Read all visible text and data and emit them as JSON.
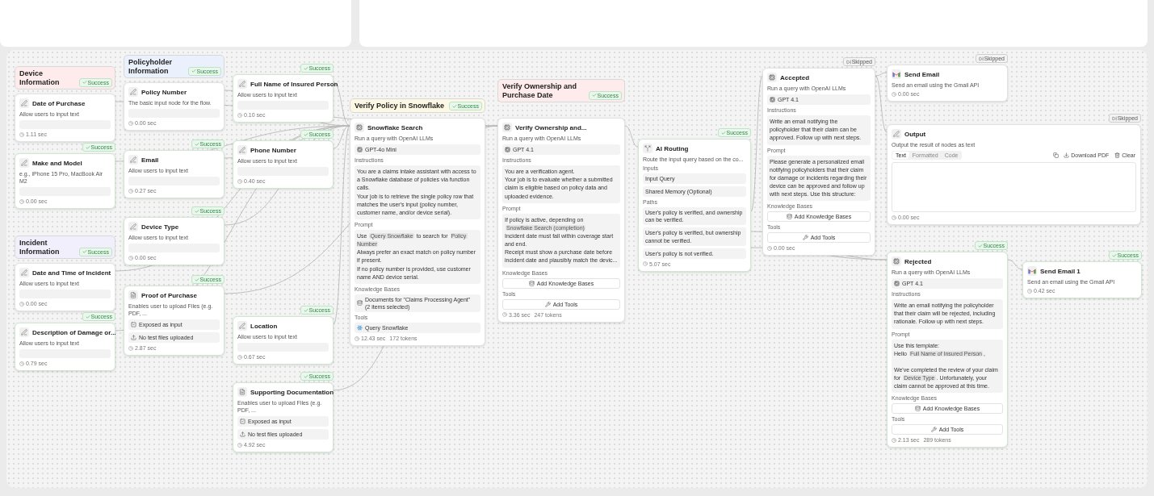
{
  "groups": [
    {
      "label": "Device Information",
      "color": "#fdeceb",
      "badge": {
        "kind": "success",
        "label": "Success"
      }
    },
    {
      "label": "Incident Information",
      "color": "#f2effc",
      "badge": {
        "kind": "success",
        "label": "Success"
      }
    },
    {
      "label": "Policyholder Information",
      "color": "#eaf1fd",
      "badge": {
        "kind": "success",
        "label": "Success"
      }
    },
    {
      "label": "Verify Policy in Snowflake",
      "color": "#fdf8e4",
      "badge": {
        "kind": "success",
        "label": "Success"
      }
    },
    {
      "label": "Verify Ownership and Purchase Date",
      "color": "#fdeceb",
      "badge": {
        "kind": "success",
        "label": "Success"
      }
    }
  ],
  "nodes": [
    {
      "kind": "input",
      "title": "Date of Purchase",
      "description": "Allow users to input text",
      "time": "1.11 sec"
    },
    {
      "kind": "input",
      "title": "Make and Model",
      "description": "e.g., iPhone 15 Pro, MacBook Air M2",
      "time": "0.00 sec",
      "badge": {
        "kind": "success",
        "label": "Success"
      }
    },
    {
      "kind": "input",
      "title": "Date and Time of Incident",
      "description": "Allow users to input text",
      "time": "0.00 sec"
    },
    {
      "kind": "input",
      "title": "Description of Damage or...",
      "description": "Allow users to input text",
      "time": "0.79 sec",
      "badge": {
        "kind": "success",
        "label": "Success"
      }
    },
    {
      "kind": "input",
      "title": "Policy Number",
      "description": "The basic input node for the flow.",
      "time": "0.00 sec"
    },
    {
      "kind": "input",
      "title": "Email",
      "description": "Allow users to input text",
      "time": "0.27 sec",
      "badge": {
        "kind": "success",
        "label": "Success"
      }
    },
    {
      "kind": "input",
      "title": "Device Type",
      "description": "Allow users to input text",
      "time": "0.00 sec",
      "badge": {
        "kind": "success",
        "label": "Success"
      }
    },
    {
      "kind": "file",
      "title": "Proof of Purchase",
      "description": "Enables user to upload Files (e.g. PDF, ...",
      "exposed": "Exposed as input",
      "files": "No test files uploaded",
      "time": "2.87 sec",
      "badge": {
        "kind": "success",
        "label": "Success"
      }
    },
    {
      "kind": "input",
      "title": "Full Name of Insured Person",
      "description": "Allow users to input text",
      "time": "0.10 sec",
      "badge": {
        "kind": "success",
        "label": "Success"
      }
    },
    {
      "kind": "input",
      "title": "Phone Number",
      "description": "Allow users to input text",
      "time": "0.40 sec",
      "badge": {
        "kind": "success",
        "label": "Success"
      }
    },
    {
      "kind": "input",
      "title": "Location",
      "description": "Allow users to input text",
      "time": "0.67 sec",
      "badge": {
        "kind": "success",
        "label": "Success"
      }
    },
    {
      "kind": "file",
      "title": "Supporting Documentation",
      "description": "Enables user to upload Files (e.g. PDF, ...",
      "exposed": "Exposed as input",
      "files": "No test files uploaded",
      "time": "4.92 sec",
      "badge": {
        "kind": "success",
        "label": "Success"
      }
    },
    {
      "kind": "llm",
      "title": "Snowflake Search",
      "subtitle": "Run a query with OpenAI LLMs",
      "model": "GPT-4o Mini",
      "instructions": {
        "label": "Instructions",
        "text": "You are a claims intake assistant with access to a Snowflake database of policies via function calls.\nYour job is to retrieve the single policy row that matches the user's input (policy number, customer name, and/or device serial)."
      },
      "prompt": {
        "label": "Prompt",
        "segments": [
          {
            "kind": "text",
            "text": "Use "
          },
          {
            "kind": "chip",
            "text": "Query Snowflake"
          },
          {
            "kind": "text",
            "text": " to search for "
          },
          {
            "kind": "chip",
            "text": "Policy Number"
          },
          {
            "kind": "text",
            "text": "\nAlways prefer an exact match on policy number if present.\nIf no policy number is provided, use customer name AND device serial."
          }
        ]
      },
      "knowledge": {
        "label": "Knowledge Bases",
        "item": {
          "kind": "selected",
          "title": "Documents for \"Claims Processing Agent\"",
          "subtitle": "(2 items selected)"
        }
      },
      "tools": {
        "label": "Tools",
        "item": {
          "kind": "tool",
          "label": "Query Snowflake"
        }
      },
      "time": "12.43 sec",
      "tokens": "172 tokens"
    },
    {
      "kind": "llm",
      "title": "Verify Ownership and...",
      "subtitle": "Run a query with OpenAI LLMs",
      "model": "GPT 4.1",
      "instructions": {
        "label": "Instructions",
        "text": "You are a verification agent.\nYour job is to evaluate whether a submitted claim is eligible based on policy data and uploaded evidence."
      },
      "prompt": {
        "label": "Prompt",
        "segments": [
          {
            "kind": "text",
            "text": "If policy is active, depending on\n"
          },
          {
            "kind": "chip",
            "text": "Snowflake Search (completion)"
          },
          {
            "kind": "text",
            "text": "\nIncident date must fall within coverage start and end.\nReceipt must show a purchase date before incident date and plausibly match the devic..."
          }
        ]
      },
      "knowledge": {
        "label": "Knowledge Bases",
        "item": {
          "kind": "button",
          "label": "Add Knowledge Bases"
        }
      },
      "tools": {
        "label": "Tools",
        "item": {
          "kind": "button",
          "label": "Add Tools"
        }
      },
      "time": "3.36 sec",
      "tokens": "247 tokens"
    },
    {
      "kind": "router",
      "title": "AI Routing",
      "description": "Route the input query based on the co...",
      "inputs_label": "Inputs",
      "inputs": [
        "Input Query",
        "Shared Memory (Optional)"
      ],
      "paths_label": "Paths",
      "paths": [
        "User's policy is verified, and ownership can be verified.",
        "User's policy is verified, but ownership cannot be verified.",
        "User's policy is not verified."
      ],
      "time": "5.07 sec",
      "badge": {
        "kind": "success",
        "label": "Success"
      }
    },
    {
      "kind": "llm",
      "title": "Accepted",
      "subtitle": "Run a query with OpenAI LLMs",
      "model": "GPT 4.1",
      "instructions": {
        "label": "Instructions",
        "text": "Write an email notifying the policyholder that their claim can be approved. Follow up with next steps."
      },
      "prompt": {
        "label": "Prompt",
        "segments": [
          {
            "kind": "text",
            "text": "Please generate a personalized email notifying policyholders that their claim for damage or incidents regarding their device can be approved and follow up with next steps. Use this structure:"
          }
        ]
      },
      "knowledge": {
        "label": "Knowledge Bases",
        "item": {
          "kind": "button",
          "label": "Add Knowledge Bases"
        }
      },
      "tools": {
        "label": "Tools",
        "item": {
          "kind": "button",
          "label": "Add Tools"
        }
      },
      "time": "0.00 sec",
      "badge": {
        "kind": "skipped",
        "label": "Skipped"
      }
    },
    {
      "kind": "email",
      "title": "Send Email",
      "description": "Send an email using the Gmail API",
      "time": "0.00 sec",
      "badge": {
        "kind": "skipped",
        "label": "Skipped"
      }
    },
    {
      "kind": "output",
      "title": "Output",
      "description": "Output the result of nodes as text",
      "tabs": [
        {
          "label": "Text",
          "selected": true
        },
        {
          "label": "Formatted",
          "selected": false
        },
        {
          "label": "Code",
          "selected": false
        }
      ],
      "download": "Download PDF",
      "clear": "Clear",
      "time": "0.00 sec",
      "badge": {
        "kind": "skipped",
        "label": "Skipped"
      }
    },
    {
      "kind": "llm",
      "title": "Rejected",
      "subtitle": "Run a query with OpenAI LLMs",
      "model": "GPT 4.1",
      "instructions": {
        "label": "Instructions",
        "text": "Write an email notifying the policyholder that their claim will be rejected, including rationale. Follow up with next steps."
      },
      "prompt": {
        "label": "Prompt",
        "segments": [
          {
            "kind": "text",
            "text": "Use this template:\nHello "
          },
          {
            "kind": "chip",
            "text": "Full Name of Insured Person"
          },
          {
            "kind": "text",
            "text": ",\n\nWe've completed the review of your claim for "
          },
          {
            "kind": "chip",
            "text": "Device Type"
          },
          {
            "kind": "text",
            "text": ". Unfortunately, your claim cannot be approved at this time."
          }
        ]
      },
      "knowledge": {
        "label": "Knowledge Bases",
        "item": {
          "kind": "button",
          "label": "Add Knowledge Bases"
        }
      },
      "tools": {
        "label": "Tools",
        "item": {
          "kind": "button",
          "label": "Add Tools"
        }
      },
      "time": "2.13 sec",
      "tokens": "289 tokens",
      "badge": {
        "kind": "success",
        "label": "Success"
      }
    },
    {
      "kind": "email",
      "title": "Send Email 1",
      "description": "Send an email using the Gmail API",
      "time": "0.42 sec",
      "badge": {
        "kind": "success",
        "label": "Success"
      }
    }
  ]
}
